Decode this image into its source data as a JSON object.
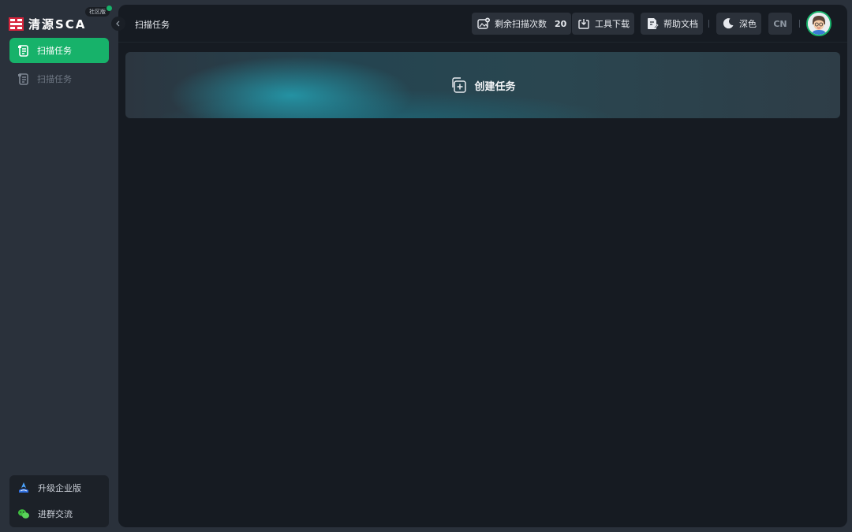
{
  "app": {
    "name": "清源SCA",
    "edition_badge": "社区版"
  },
  "sidebar": {
    "items": [
      {
        "label": "扫描任务",
        "icon": "scroll-icon",
        "active": true
      },
      {
        "label": "扫描任务",
        "icon": "scroll-icon",
        "active": false
      }
    ],
    "bottom": [
      {
        "label": "升级企业版",
        "icon": "enterprise-icon"
      },
      {
        "label": "进群交流",
        "icon": "wechat-icon"
      }
    ]
  },
  "header": {
    "breadcrumb": "扫描任务",
    "remaining_scans": {
      "label": "剩余扫描次数",
      "value": "20"
    },
    "tool_download": "工具下载",
    "help_docs": "帮助文档",
    "theme": "深色",
    "language": "CN"
  },
  "main": {
    "create_task": "创建任务"
  },
  "colors": {
    "accent": "#17b26a",
    "panel": "#161b22",
    "sidebar": "#2a313b"
  }
}
